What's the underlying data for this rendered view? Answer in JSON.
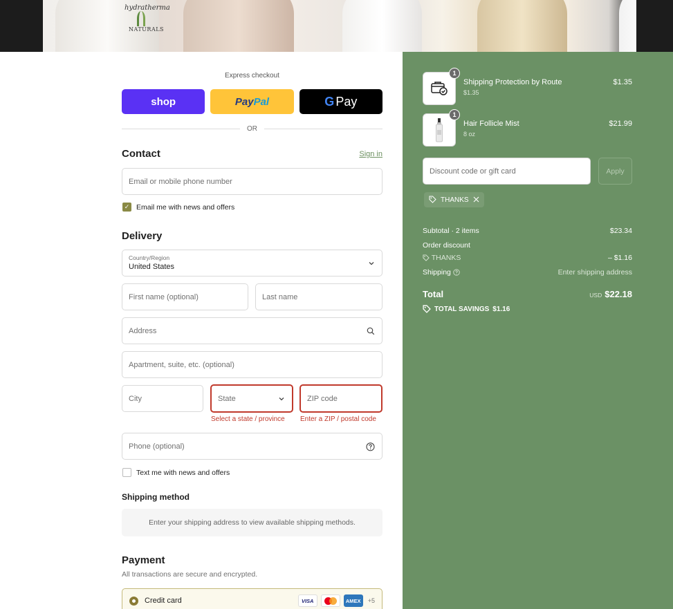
{
  "banner": {
    "brand_line1": "hydratherma",
    "brand_line2": "NATURALS"
  },
  "express": {
    "label": "Express checkout",
    "shop_label": "shop",
    "paypal_part1": "Pay",
    "paypal_part2": "Pal",
    "gpay_g": "G",
    "gpay_label": "Pay",
    "or_label": "OR"
  },
  "contact": {
    "title": "Contact",
    "sign_in": "Sign in",
    "email_placeholder": "Email or mobile phone number",
    "news_label": "Email me with news and offers"
  },
  "delivery": {
    "title": "Delivery",
    "country_label": "Country/Region",
    "country_value": "United States",
    "first_name": "First name (optional)",
    "last_name": "Last name",
    "address": "Address",
    "apartment": "Apartment, suite, etc. (optional)",
    "city": "City",
    "state": "State",
    "zip": "ZIP code",
    "state_error": "Select a state / province",
    "zip_error": "Enter a ZIP / postal code",
    "phone": "Phone (optional)",
    "text_news": "Text me with news and offers"
  },
  "shipping_method": {
    "title": "Shipping method",
    "message": "Enter your shipping address to view available shipping methods."
  },
  "payment": {
    "title": "Payment",
    "subtitle": "All transactions are secure and encrypted.",
    "credit_card": "Credit card",
    "visa": "VISA",
    "amex": "AMEX",
    "more": "+5"
  },
  "summary": {
    "items": [
      {
        "name": "Shipping Protection by Route",
        "sub": "$1.35",
        "price": "$1.35",
        "qty": "1"
      },
      {
        "name": "Hair Follicle Mist",
        "sub": "8 oz",
        "price": "$21.99",
        "qty": "1"
      }
    ],
    "discount_placeholder": "Discount code or gift card",
    "apply": "Apply",
    "tag_code": "THANKS",
    "subtotal_label": "Subtotal · 2 items",
    "subtotal_value": "$23.34",
    "order_discount_label": "Order discount",
    "discount_code": "THANKS",
    "discount_value": "– $1.16",
    "shipping_label": "Shipping",
    "shipping_value": "Enter shipping address",
    "total_label": "Total",
    "currency": "USD",
    "total_value": "$22.18",
    "savings_label": "TOTAL SAVINGS",
    "savings_value": "$1.16"
  }
}
